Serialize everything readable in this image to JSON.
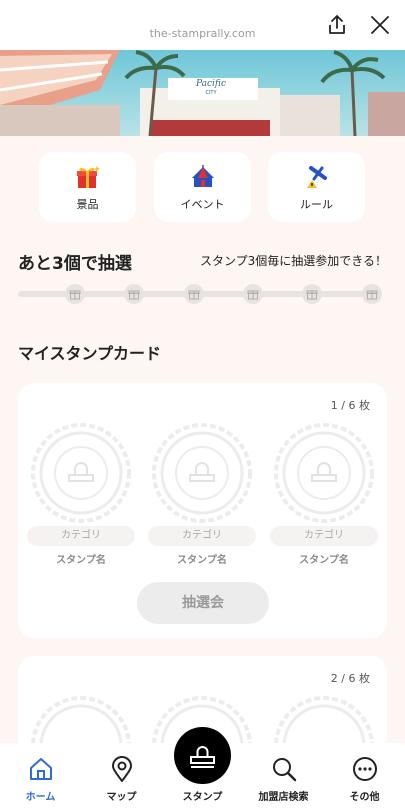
{
  "header": {
    "url": "the-stamprally.com",
    "share_icon": "share-icon",
    "close_icon": "close-icon"
  },
  "hero": {
    "sign_text": "Pacific",
    "sign_subtext": "CITY"
  },
  "menu": [
    {
      "label": "景品",
      "icon": "gift-icon"
    },
    {
      "label": "イベント",
      "icon": "tent-icon"
    },
    {
      "label": "ルール",
      "icon": "pin-icon"
    }
  ],
  "lottery": {
    "title": "あと3個で抽選",
    "subtitle": "スタンプ3個毎に抽選参加できる！",
    "filled": 0,
    "milestones": 6
  },
  "my_card": {
    "title": "マイスタンプカード",
    "cards": [
      {
        "counter": "1 / 6 枚",
        "stamps": [
          {
            "category": "カテゴリ",
            "name": "スタンプ名"
          },
          {
            "category": "カテゴリ",
            "name": "スタンプ名"
          },
          {
            "category": "カテゴリ",
            "name": "スタンプ名"
          }
        ],
        "button_label": "抽選会"
      },
      {
        "counter": "2 / 6 枚"
      }
    ]
  },
  "tabbar": {
    "tabs": [
      {
        "label": "ホーム",
        "icon": "home-icon",
        "active": true
      },
      {
        "label": "マップ",
        "icon": "map-pin-icon",
        "active": false
      },
      {
        "label": "スタンプ",
        "icon": "stamp-icon",
        "active": false
      },
      {
        "label": "加盟店検索",
        "icon": "search-icon",
        "active": false
      },
      {
        "label": "その他",
        "icon": "more-icon",
        "active": false
      }
    ]
  },
  "colors": {
    "accent": "#2f6bd6",
    "background": "#fdf6f2",
    "card": "#ffffff",
    "disabled": "#ececec"
  }
}
